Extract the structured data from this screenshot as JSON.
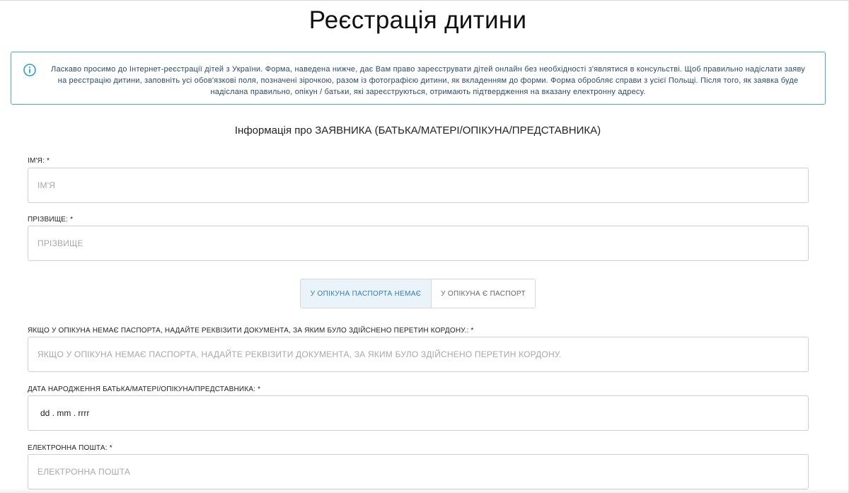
{
  "page": {
    "title": "Реєстрація дитини"
  },
  "info": {
    "icon": "info-circle-icon",
    "text": "Ласкаво просимо до Інтернет-реєстрації дітей з України. Форма, наведена нижче, дає Вам право зареєструвати дітей онлайн без необхідності з'являтися в консульстві. Щоб правильно надіслати заяву на реєстрацію дитини, заповніть усі обов'язкові поля, позначені зірочкою, разом із фотографією дитини, як вкладенням до форми. Форма обробляє справи з усієї Польщі. Після того, як заявка буде надіслана правильно, опікун / батьки, які зареєструються, отримають підтвердження на вказану електронну адресу."
  },
  "section": {
    "heading": "Інформація про ЗАЯВНИКА (БАТЬКА/МАТЕРІ/ОПІКУНА/ПРЕДСТАВНИКА)"
  },
  "form": {
    "first_name": {
      "label": "ІМ'Я: *",
      "placeholder": "ІМ'Я"
    },
    "last_name": {
      "label": "ПРІЗВИЩЕ: *",
      "placeholder": "ПРІЗВИЩЕ"
    },
    "passport_toggle": {
      "no_passport": "У ОПІКУНА ПАСПОРТА НЕМАЄ",
      "has_passport": "У ОПІКУНА Є ПАСПОРТ",
      "selected": "no_passport"
    },
    "border_document": {
      "label": "ЯКЩО У ОПІКУНА НЕМАЄ ПАСПОРТА, НАДАЙТЕ РЕКВІЗИТИ ДОКУМЕНТА, ЗА ЯКИМ БУЛО ЗДІЙСНЕНО ПЕРЕТИН КОРДОНУ.: *",
      "placeholder": "ЯКЩО У ОПІКУНА НЕМАЄ ПАСПОРТА, НАДАЙТЕ РЕКВІЗИТИ ДОКУМЕНТА, ЗА ЯКИМ БУЛО ЗДІЙСНЕНО ПЕРЕТИН КОРДОНУ."
    },
    "birth_date": {
      "label": "ДАТА НАРОДЖЕННЯ БАТЬКА/МАТЕРІ/ОПІКУНА/ПРЕДСТАВНИКА: *",
      "value": "dd . mm . rrrr"
    },
    "email": {
      "label": "ЕЛЕКТРОННА ПОШТА: *",
      "placeholder": "ЕЛЕКТРОННА ПОШТА"
    }
  },
  "colors": {
    "info_border": "#4aa8d8",
    "info_text": "#2a4a66",
    "toggle_active_bg": "#eaf2fa",
    "toggle_active_text": "#2f7fc0"
  }
}
